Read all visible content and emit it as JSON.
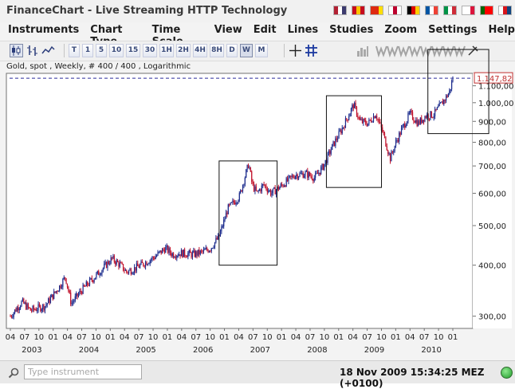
{
  "window": {
    "title": "FinanceChart - Live Streaming HTTP Technology"
  },
  "flags": [
    {
      "name": "us-flag-icon",
      "colors": [
        "#b22234",
        "#ffffff",
        "#3c3b6e"
      ]
    },
    {
      "name": "es-flag-icon",
      "colors": [
        "#c60b1e",
        "#ffc400",
        "#c60b1e"
      ]
    },
    {
      "name": "cn-flag-icon",
      "colors": [
        "#de2910",
        "#de2910",
        "#ffde00"
      ]
    },
    {
      "name": "jp-flag-icon",
      "colors": [
        "#ffffff",
        "#bc002d",
        "#ffffff"
      ]
    },
    {
      "name": "de-flag-icon",
      "colors": [
        "#000000",
        "#dd0000",
        "#ffce00"
      ]
    },
    {
      "name": "fr-flag-icon",
      "colors": [
        "#0055a4",
        "#ffffff",
        "#ef4135"
      ]
    },
    {
      "name": "it-flag-icon",
      "colors": [
        "#009246",
        "#ffffff",
        "#ce2b37"
      ]
    },
    {
      "name": "pl-flag-icon",
      "colors": [
        "#ffffff",
        "#ffffff",
        "#dc143c"
      ]
    },
    {
      "name": "pt-flag-icon",
      "colors": [
        "#006600",
        "#ff0000",
        "#ff0000"
      ]
    },
    {
      "name": "cz-flag-icon",
      "colors": [
        "#ffffff",
        "#d7141a",
        "#11457e"
      ]
    }
  ],
  "menu": [
    "Instruments",
    "Chart Type",
    "Time Scale",
    "View",
    "Edit",
    "Lines",
    "Studies",
    "Zoom",
    "Settings",
    "Help"
  ],
  "toolbar": {
    "chart_types": [
      "candle-chart-icon",
      "ohlc-chart-icon",
      "line-chart-icon"
    ],
    "time_scales": [
      "T",
      "1",
      "5",
      "10",
      "15",
      "30",
      "1H",
      "2H",
      "4H",
      "8H",
      "D",
      "W",
      "M"
    ],
    "selected_scale": "W",
    "tools": [
      "crosshair-icon",
      "grid-icon",
      "studies-icon",
      "wave-tool-icon",
      "wave-tool-icon",
      "wave-tool-icon",
      "wave-tool-icon",
      "wave-tool-icon",
      "wave-tool-icon",
      "wave-tool-icon",
      "wave-tool-icon",
      "pointer-icon"
    ]
  },
  "info_line": "Gold, spot , Weekly, # 400 / 400 , Logarithmic",
  "chart_data": {
    "type": "candlestick",
    "title": "Gold, spot , Weekly, # 400 / 400 , Logarithmic",
    "scale": "log",
    "ylim": [
      280,
      1180
    ],
    "y_ticks": [
      "300,00",
      "400,00",
      "500,00",
      "600,00",
      "700,00",
      "800,00",
      "900,00",
      "1.000,00",
      "1.100,00"
    ],
    "y_tick_values": [
      300,
      400,
      500,
      600,
      700,
      800,
      900,
      1000,
      1100
    ],
    "last_price_label": "1.147,82",
    "last_price": 1147.82,
    "x_month_labels": [
      "04",
      "07",
      "10",
      "01",
      "04",
      "07",
      "10",
      "01",
      "04",
      "07",
      "10",
      "01",
      "04",
      "07",
      "10",
      "01",
      "04",
      "07",
      "10",
      "01",
      "04",
      "07",
      "10",
      "01",
      "04",
      "07",
      "10",
      "01",
      "04",
      "07",
      "10",
      "01"
    ],
    "x_year_labels": [
      "2003",
      "2004",
      "2005",
      "2006",
      "2007",
      "2008",
      "2009",
      "2010"
    ],
    "x_start": 2002.25,
    "x_end": 2009.88,
    "price_path": [
      [
        2002.25,
        300
      ],
      [
        2002.45,
        325
      ],
      [
        2002.6,
        310
      ],
      [
        2002.85,
        318
      ],
      [
        2003.1,
        355
      ],
      [
        2003.2,
        375
      ],
      [
        2003.3,
        322
      ],
      [
        2003.5,
        350
      ],
      [
        2003.75,
        380
      ],
      [
        2004.0,
        415
      ],
      [
        2004.15,
        400
      ],
      [
        2004.25,
        385
      ],
      [
        2004.35,
        390
      ],
      [
        2004.5,
        400
      ],
      [
        2004.75,
        420
      ],
      [
        2004.92,
        440
      ],
      [
        2005.05,
        425
      ],
      [
        2005.2,
        428
      ],
      [
        2005.4,
        425
      ],
      [
        2005.55,
        430
      ],
      [
        2005.7,
        440
      ],
      [
        2005.85,
        470
      ],
      [
        2006.0,
        550
      ],
      [
        2006.2,
        590
      ],
      [
        2006.36,
        710
      ],
      [
        2006.42,
        630
      ],
      [
        2006.5,
        600
      ],
      [
        2006.62,
        630
      ],
      [
        2006.75,
        600
      ],
      [
        2006.95,
        630
      ],
      [
        2007.15,
        665
      ],
      [
        2007.35,
        670
      ],
      [
        2007.5,
        655
      ],
      [
        2007.65,
        700
      ],
      [
        2007.8,
        780
      ],
      [
        2008.0,
        880
      ],
      [
        2008.17,
        990
      ],
      [
        2008.28,
        900
      ],
      [
        2008.42,
        890
      ],
      [
        2008.55,
        940
      ],
      [
        2008.68,
        840
      ],
      [
        2008.8,
        730
      ],
      [
        2008.9,
        800
      ],
      [
        2009.0,
        860
      ],
      [
        2009.14,
        940
      ],
      [
        2009.28,
        890
      ],
      [
        2009.42,
        930
      ],
      [
        2009.55,
        935
      ],
      [
        2009.7,
        1000
      ],
      [
        2009.82,
        1060
      ],
      [
        2009.88,
        1147.82
      ]
    ],
    "annotation_boxes": [
      {
        "x": [
          2005.85,
          2006.85
        ],
        "y": [
          400,
          720
        ]
      },
      {
        "x": [
          2007.7,
          2008.65
        ],
        "y": [
          620,
          1040
        ]
      },
      {
        "x": [
          2009.45,
          2010.5
        ],
        "y": [
          840,
          1350
        ]
      }
    ],
    "colors": {
      "up": "#1a2a8c",
      "down": "#c0102a",
      "last_price_line": "#2a2a9a",
      "box": "#111111"
    }
  },
  "status": {
    "search_placeholder": "Type instrument",
    "clock": "18 Nov 2009 15:34:25  MEZ (+0100)",
    "led_color": "#2fb43a"
  }
}
